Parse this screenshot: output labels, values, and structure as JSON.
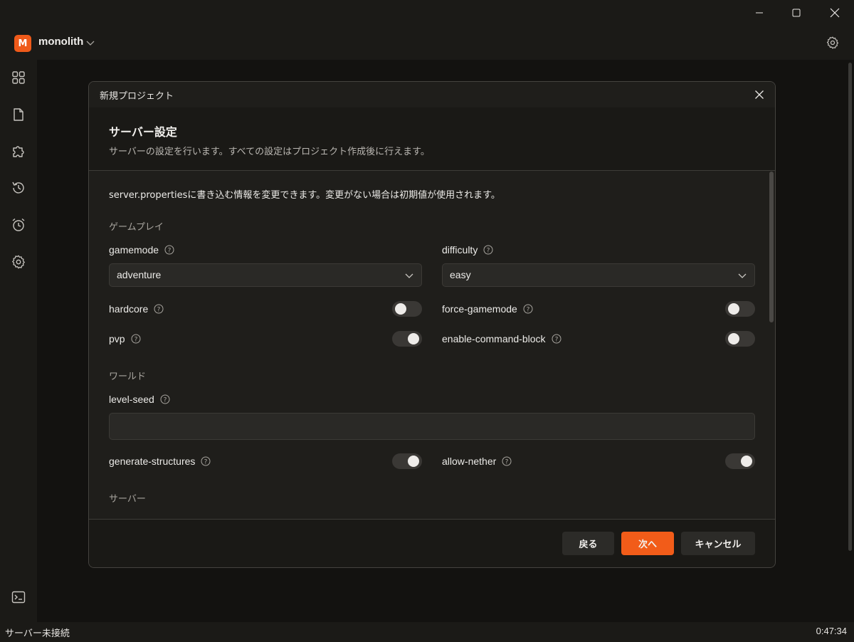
{
  "app": {
    "logo_letter": "M",
    "name": "monolith"
  },
  "dialog": {
    "title": "新規プロジェクト",
    "heading": "サーバー設定",
    "subtitle": "サーバーの設定を行います。すべての設定はプロジェクト作成後に行えます。",
    "description": "server.propertiesに書き込む情報を変更できます。変更がない場合は初期値が使用されます。",
    "sections": {
      "gameplay": "ゲームプレイ",
      "world": "ワールド",
      "server": "サーバー"
    },
    "fields": {
      "gamemode": {
        "label": "gamemode",
        "value": "adventure"
      },
      "difficulty": {
        "label": "difficulty",
        "value": "easy"
      },
      "hardcore": {
        "label": "hardcore",
        "on": false
      },
      "force_gamemode": {
        "label": "force-gamemode",
        "on": false
      },
      "pvp": {
        "label": "pvp",
        "on": true
      },
      "enable_command_block": {
        "label": "enable-command-block",
        "on": false
      },
      "level_seed": {
        "label": "level-seed",
        "value": ""
      },
      "generate_structures": {
        "label": "generate-structures",
        "on": true
      },
      "allow_nether": {
        "label": "allow-nether",
        "on": true
      }
    },
    "buttons": {
      "back": "戻る",
      "next": "次へ",
      "cancel": "キャンセル"
    }
  },
  "status": {
    "connection": "サーバー未接続",
    "time": "0:47:34"
  },
  "colors": {
    "accent": "#f25c19",
    "background": "#131210",
    "dialog": "#1f1e1b"
  }
}
